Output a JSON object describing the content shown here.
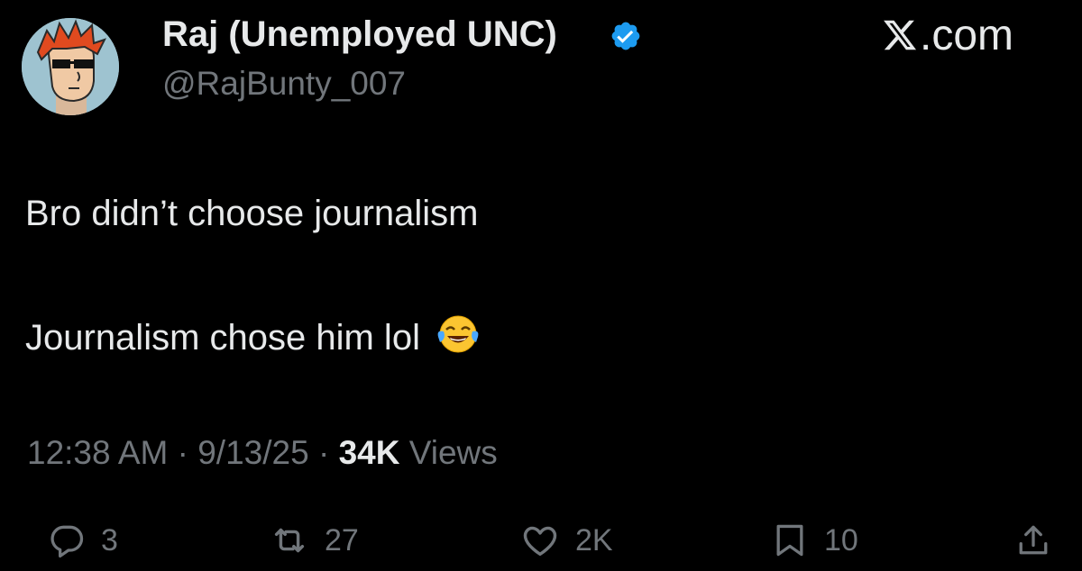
{
  "author": {
    "display_name": "Raj (Unemployed UNC)",
    "handle": "@RajBunty_007",
    "verified": true,
    "avatar_icon": "cartoon-avatar-icon"
  },
  "brand": {
    "label": ".com"
  },
  "tweet": {
    "line1": "Bro didn’t choose journalism",
    "line2": "Journalism chose him lol",
    "emoji": "face-with-tears-of-joy"
  },
  "meta": {
    "time": "12:38 AM",
    "separator": " · ",
    "date": "9/13/25",
    "views_count": "34K",
    "views_label": "Views"
  },
  "actions": {
    "replies": "3",
    "reposts": "27",
    "likes": "2K",
    "bookmarks": "10"
  },
  "colors": {
    "background": "#000000",
    "text": "#e7e9ea",
    "muted": "#71767b",
    "verified_blue": "#1d9bf0"
  }
}
